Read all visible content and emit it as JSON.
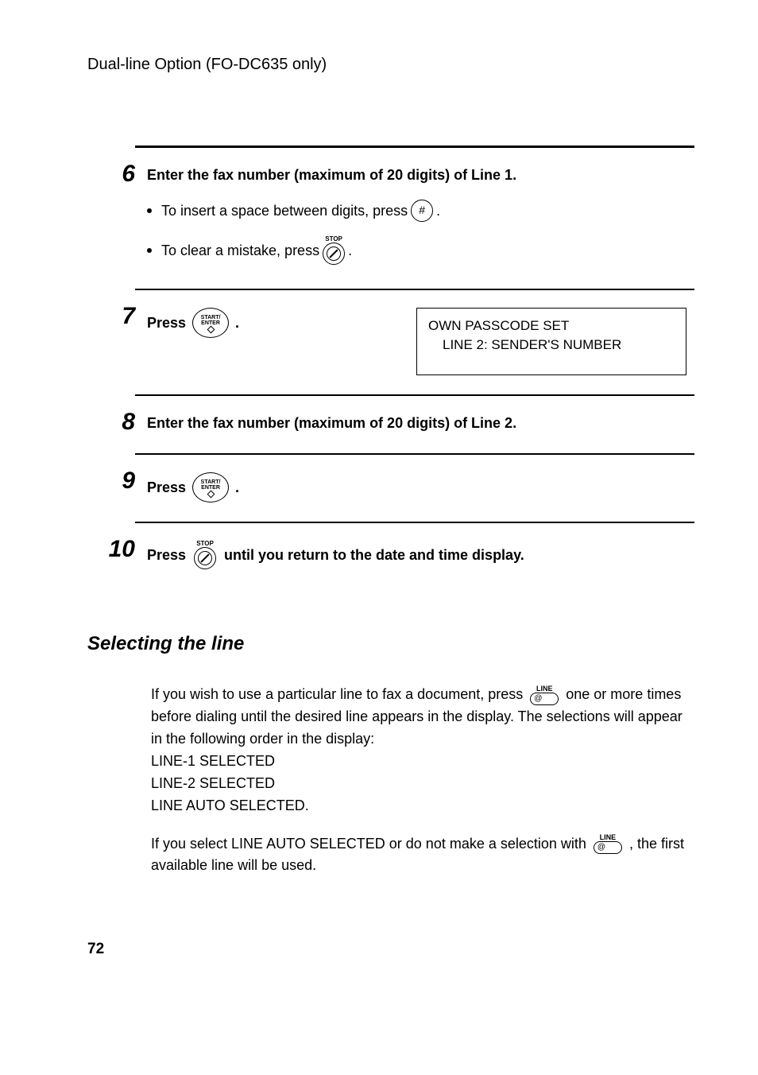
{
  "header": "Dual-line Option (FO-DC635 only)",
  "step6": {
    "num": "6",
    "title": "Enter the fax number (maximum of 20 digits) of Line 1.",
    "bullet1_pre": "To insert  a space between digits, press ",
    "bullet1_post": " .",
    "bullet2_pre": "To clear a mistake, press ",
    "bullet2_post": " ."
  },
  "step7": {
    "num": "7",
    "press": "Press ",
    "dot": ".",
    "display_line1": "OWN PASSCODE SET",
    "display_line2": "LINE 2: SENDER'S NUMBER"
  },
  "step8": {
    "num": "8",
    "title": "Enter the fax number (maximum of 20 digits) of Line 2."
  },
  "step9": {
    "num": "9",
    "press": "Press ",
    "dot": "."
  },
  "step10": {
    "num": "10",
    "press": "Press ",
    "rest": " until you return to the date and time display."
  },
  "section_title": "Selecting the line",
  "para1_a": "If you wish to use a particular line to fax a document, press ",
  "para1_b": " one or more times before dialing until the desired line appears in the display. The selections will appear in the following order in the display:",
  "para1_l1": "LINE-1 SELECTED",
  "para1_l2": "LINE-2 SELECTED",
  "para1_l3": "LINE AUTO SELECTED.",
  "para2_a": "If you select LINE AUTO SELECTED or do not make a selection with ",
  "para2_b": " , the first available line will be used.",
  "icons": {
    "stop": "STOP",
    "start": "START/",
    "enter": "ENTER",
    "line": "LINE",
    "at": "@",
    "hash": "#"
  },
  "page_num": "72"
}
